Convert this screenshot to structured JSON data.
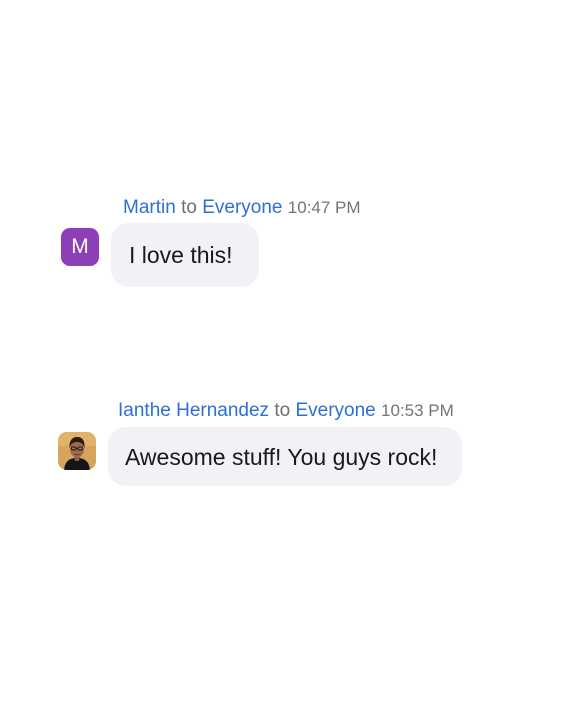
{
  "messages": [
    {
      "sender": "Martin",
      "connector": "to",
      "recipient": "Everyone",
      "time": "10:47 PM",
      "avatar_initial": "M",
      "avatar_color": "#8d3fb7",
      "text": "I love this!"
    },
    {
      "sender": "Ianthe Hernandez",
      "connector": "to",
      "recipient": "Everyone",
      "time": "10:53 PM",
      "avatar_type": "photo",
      "text": "Awesome stuff! You guys rock!"
    }
  ],
  "colors": {
    "name_link": "#2d6fd4",
    "meta_text": "#6e6e73",
    "bubble_bg": "#f1f1f6",
    "message_text": "#1a1a1a"
  }
}
